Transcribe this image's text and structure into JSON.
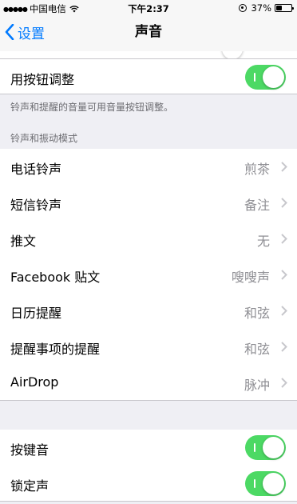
{
  "status_bar": {
    "carrier": "中国电信",
    "time": "下午2:37",
    "battery": "37%",
    "battery_level": 0.37,
    "signal_dots": "●●●●●"
  },
  "nav": {
    "back_label": "设置",
    "title": "声音"
  },
  "ringer": {
    "change_with_buttons_label": "用按钮调整",
    "change_with_buttons_on": true,
    "footer": "铃声和提醒的音量可用音量按钮调整。"
  },
  "patterns": {
    "header": "铃声和振动模式",
    "items": [
      {
        "label": "电话铃声",
        "value": "煎茶"
      },
      {
        "label": "短信铃声",
        "value": "备注"
      },
      {
        "label": "推文",
        "value": "无"
      },
      {
        "label": "Facebook 贴文",
        "value": "嗖嗖声"
      },
      {
        "label": "日历提醒",
        "value": "和弦"
      },
      {
        "label": "提醒事项的提醒",
        "value": "和弦"
      },
      {
        "label": "AirDrop",
        "value": "脉冲"
      }
    ]
  },
  "system_sounds": {
    "items": [
      {
        "label": "按键音",
        "on": true
      },
      {
        "label": "锁定声",
        "on": true
      }
    ]
  },
  "colors": {
    "accent": "#007aff",
    "toggle_on": "#4cd964",
    "secondary_text": "#8e8e93"
  }
}
